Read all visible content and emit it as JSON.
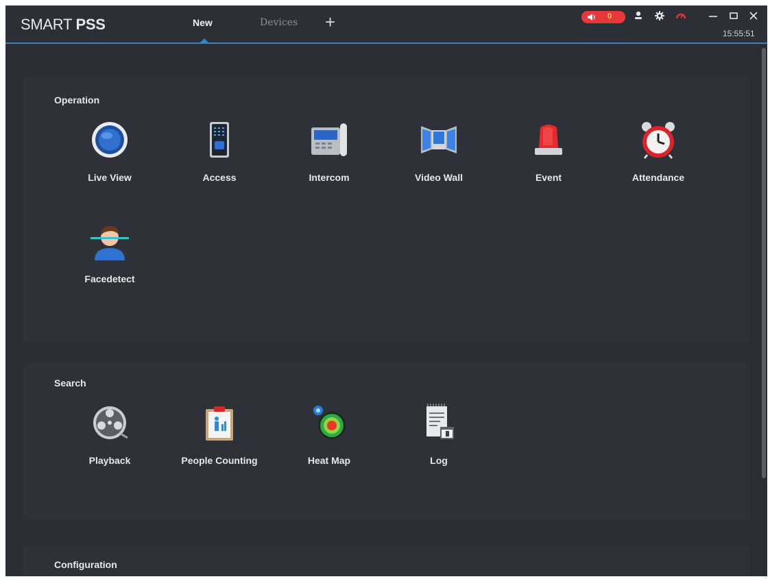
{
  "app": {
    "logo_light": "SMART ",
    "logo_bold": "PSS",
    "tabs": [
      {
        "label": "New",
        "active": true
      },
      {
        "label": "Devices",
        "active": false
      }
    ],
    "alarm_count": "0",
    "clock": "15:55:51",
    "accent": "#2d86c9"
  },
  "sections": {
    "operation": {
      "title": "Operation",
      "items": [
        {
          "label": "Live View",
          "icon": "live-view-icon"
        },
        {
          "label": "Access",
          "icon": "access-icon"
        },
        {
          "label": "Intercom",
          "icon": "intercom-icon"
        },
        {
          "label": "Video Wall",
          "icon": "video-wall-icon"
        },
        {
          "label": "Event",
          "icon": "event-icon"
        },
        {
          "label": "Attendance",
          "icon": "attendance-icon"
        },
        {
          "label": "Facedetect",
          "icon": "facedetect-icon"
        }
      ]
    },
    "search": {
      "title": "Search",
      "items": [
        {
          "label": "Playback",
          "icon": "playback-icon"
        },
        {
          "label": "People Counting",
          "icon": "people-counting-icon"
        },
        {
          "label": "Heat Map",
          "icon": "heat-map-icon"
        },
        {
          "label": "Log",
          "icon": "log-icon"
        }
      ]
    },
    "configuration": {
      "title": "Configuration"
    }
  }
}
